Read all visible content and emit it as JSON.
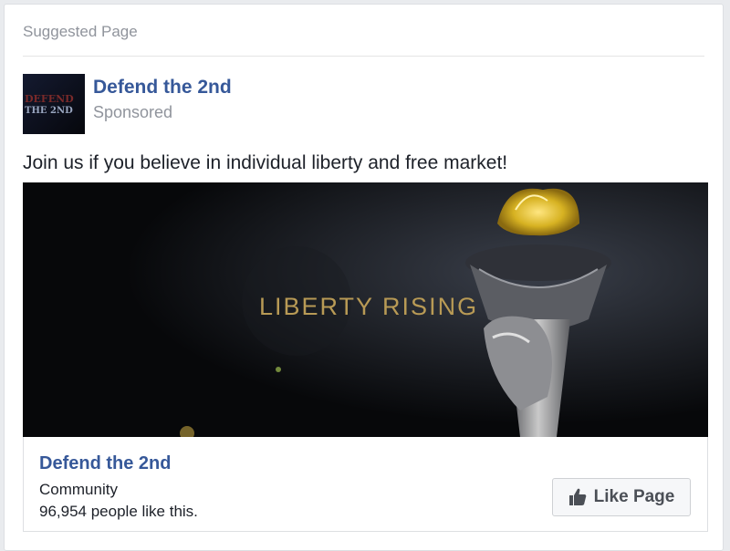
{
  "card": {
    "header": "Suggested Page"
  },
  "page": {
    "name": "Defend the 2nd",
    "sponsored_label": "Sponsored",
    "avatar_text_line1": "DEFEND",
    "avatar_text_line2": "THE 2ND"
  },
  "post": {
    "text": "Join us if you believe in individual liberty and free market!"
  },
  "banner": {
    "title": "LIBERTY RISING",
    "icon": "torch-image"
  },
  "footer": {
    "name": "Defend the 2nd",
    "category": "Community",
    "likes": "96,954 people like this.",
    "like_button_label": "Like Page",
    "like_icon": "thumbs-up-icon"
  },
  "colors": {
    "link_blue": "#365899",
    "muted_gray": "#90949c",
    "text_dark": "#1d2129",
    "banner_gold": "#b89a55"
  }
}
